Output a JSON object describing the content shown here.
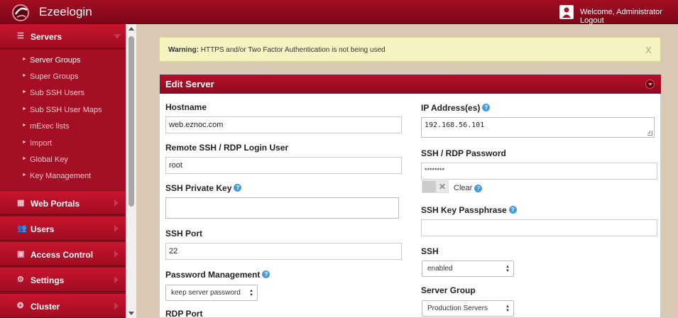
{
  "app": {
    "brand": "Ezeelogin",
    "welcome": "Welcome, Administrator Logout"
  },
  "sidebar": {
    "sections": [
      {
        "label": "Servers",
        "icon": "list-icon",
        "expanded": true
      },
      {
        "label": "Web Portals",
        "icon": "grid-icon"
      },
      {
        "label": "Users",
        "icon": "users-icon"
      },
      {
        "label": "Access Control",
        "icon": "lock-icon"
      },
      {
        "label": "Settings",
        "icon": "gears-icon"
      },
      {
        "label": "Cluster",
        "icon": "cluster-icon"
      }
    ],
    "items": [
      {
        "label": "Server Groups",
        "active": true
      },
      {
        "label": "Super Groups"
      },
      {
        "label": "Sub SSH Users"
      },
      {
        "label": "Sub SSH User Maps"
      },
      {
        "label": "mExec lists"
      },
      {
        "label": "Import"
      },
      {
        "label": "Global Key"
      },
      {
        "label": "Key Management"
      }
    ]
  },
  "warning": {
    "prefix": "Warning:",
    "message": "HTTPS and/or Two Factor Authentication is not being used",
    "close": "X"
  },
  "panel": {
    "title": "Edit Server"
  },
  "form": {
    "hostname": {
      "label": "Hostname",
      "value": "web.eznoc.com"
    },
    "login_user": {
      "label": "Remote SSH / RDP Login User",
      "value": "root"
    },
    "private_key": {
      "label": "SSH Private Key",
      "value": ""
    },
    "ssh_port": {
      "label": "SSH Port",
      "value": "22"
    },
    "password_mgmt": {
      "label": "Password Management",
      "value": "keep server password"
    },
    "rdp_port": {
      "label": "RDP Port"
    },
    "ip": {
      "label": "IP Address(es)",
      "value": "192.168.56.101"
    },
    "password": {
      "label": "SSH / RDP Password",
      "value": "********"
    },
    "clear": "Clear",
    "passphrase": {
      "label": "SSH Key Passphrase",
      "value": ""
    },
    "ssh": {
      "label": "SSH",
      "value": "enabled"
    },
    "server_group": {
      "label": "Server Group",
      "value": "Production Servers"
    }
  },
  "help_glyph": "?"
}
